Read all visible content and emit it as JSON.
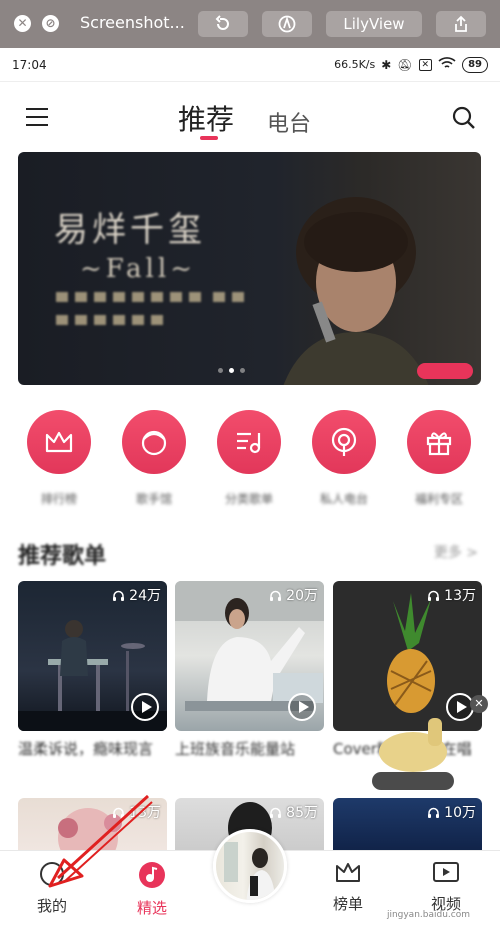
{
  "window": {
    "title": "Screenshot...",
    "lilyview_label": "LilyView"
  },
  "status": {
    "time": "17:04",
    "speed": "66.5K/s",
    "battery": "89"
  },
  "header": {
    "tab_recommend": "推荐",
    "tab_radio": "电台"
  },
  "banner": {
    "title": "易烊千玺",
    "subtitle": "~Fall~"
  },
  "quick_items": [
    {
      "icon": "crown-icon",
      "label": "排行榜"
    },
    {
      "icon": "face-icon",
      "label": "歌手馆"
    },
    {
      "icon": "music-list-icon",
      "label": "分类歌单"
    },
    {
      "icon": "radio-icon",
      "label": "私人电台"
    },
    {
      "icon": "gift-icon",
      "label": "福利专区"
    }
  ],
  "section": {
    "title": "推荐歌单",
    "more": "更多 >"
  },
  "playlists": [
    {
      "count": "24万",
      "title": "温柔诉说，瘾味现言",
      "colors": [
        "#1c2633",
        "#384352"
      ]
    },
    {
      "count": "20万",
      "title": "上班族音乐能量站",
      "colors": [
        "#d8d9d6",
        "#8f9ba0"
      ]
    },
    {
      "count": "13万",
      "title": "Cover精选·谁还在唱",
      "colors": [
        "#2b2b2b",
        "#3a3a3a"
      ]
    }
  ],
  "playlists_row2": [
    {
      "count": "13万"
    },
    {
      "count": "85万"
    },
    {
      "count": "10万"
    }
  ],
  "bottom_nav": {
    "mine": "我的",
    "featured": "精选",
    "charts": "榜单",
    "video": "视频"
  },
  "watermark": "jingyan.baidu.com",
  "colors": {
    "accent": "#e8345a",
    "toolbar": "#8c8584"
  }
}
